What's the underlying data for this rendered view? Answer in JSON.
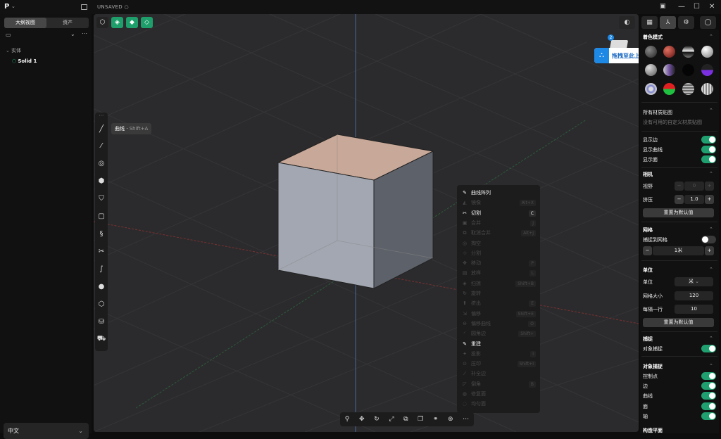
{
  "app": {
    "logo": "P",
    "title": "UNSAVED"
  },
  "left": {
    "tab_outline": "大纲视图",
    "tab_assets": "资产",
    "group": "实体",
    "item": "Solid 1",
    "lang": "中文"
  },
  "tooltip": {
    "name": "曲线",
    "shortcut": "Shift+A"
  },
  "upload": {
    "label": "拖拽至此上传",
    "badge": "2"
  },
  "context_menu": [
    {
      "label": "曲线阵列",
      "key": "",
      "en": true,
      "icon": "✎"
    },
    {
      "label": "镜像",
      "key": "Alt+X",
      "en": false,
      "icon": "◭"
    },
    {
      "label": "切割",
      "key": "C",
      "en": true,
      "icon": "✂"
    },
    {
      "label": "合并",
      "key": "J",
      "en": false,
      "icon": "▣"
    },
    {
      "label": "取消合并",
      "key": "Alt+J",
      "en": false,
      "icon": "⧉"
    },
    {
      "label": "掏空",
      "key": "",
      "en": false,
      "icon": "◎"
    },
    {
      "label": "分割",
      "key": "",
      "en": false,
      "icon": "⊹"
    },
    {
      "label": "移动",
      "key": "P",
      "en": false,
      "icon": "✥"
    },
    {
      "label": "放样",
      "key": "L",
      "en": false,
      "icon": "▤"
    },
    {
      "label": "扫掠",
      "key": "Shift+B",
      "en": false,
      "icon": "◈"
    },
    {
      "label": "旋转",
      "key": "",
      "en": false,
      "icon": "↻"
    },
    {
      "label": "挤出",
      "key": "E",
      "en": false,
      "icon": "⬆"
    },
    {
      "label": "偏移",
      "key": "Shift+E",
      "en": false,
      "icon": "⇲"
    },
    {
      "label": "偏移曲线",
      "key": "O",
      "en": false,
      "icon": "⊖"
    },
    {
      "label": "圆角边",
      "key": "Shift+",
      "en": false,
      "icon": "◜"
    },
    {
      "label": "重建",
      "key": "",
      "en": true,
      "icon": "✎"
    },
    {
      "label": "投影",
      "key": "I",
      "en": false,
      "icon": "✦"
    },
    {
      "label": "压印",
      "key": "Shift+I",
      "en": false,
      "icon": "⊙"
    },
    {
      "label": "补全边",
      "key": "",
      "en": false,
      "icon": "⁄"
    },
    {
      "label": "倒角",
      "key": "B",
      "en": false,
      "icon": "◸"
    },
    {
      "label": "修复面",
      "key": "",
      "en": false,
      "icon": "◍"
    },
    {
      "label": "均匀面",
      "key": "",
      "en": false,
      "icon": "◌"
    }
  ],
  "right": {
    "shading_title": "着色模式",
    "all_textures": "所有材质贴图",
    "no_textures": "没有可用的自定义材质贴图",
    "show_edges": "显示边",
    "show_curves": "显示曲线",
    "show_faces": "显示面",
    "camera_title": "相机",
    "fov": "视野",
    "fov_val": "0",
    "pinch": "挤压",
    "pinch_val": "1.0",
    "reset": "重置为默认值",
    "grid_title": "网格",
    "snap_grid": "捕捉到网格",
    "grid_step": "1米",
    "units_title": "单位",
    "units": "单位",
    "units_val": "米",
    "grid_size": "网格大小",
    "grid_size_val": "120",
    "per_row": "每隔一行",
    "per_row_val": "10",
    "reset2": "重置为默认值",
    "snap_title": "捕捉",
    "obj_snap": "对象捕捉",
    "obj_snap_title": "对象捕捉",
    "cp": "控制点",
    "edge": "边",
    "curve": "曲线",
    "face": "面",
    "axis": "轴",
    "more": "构造平面"
  }
}
